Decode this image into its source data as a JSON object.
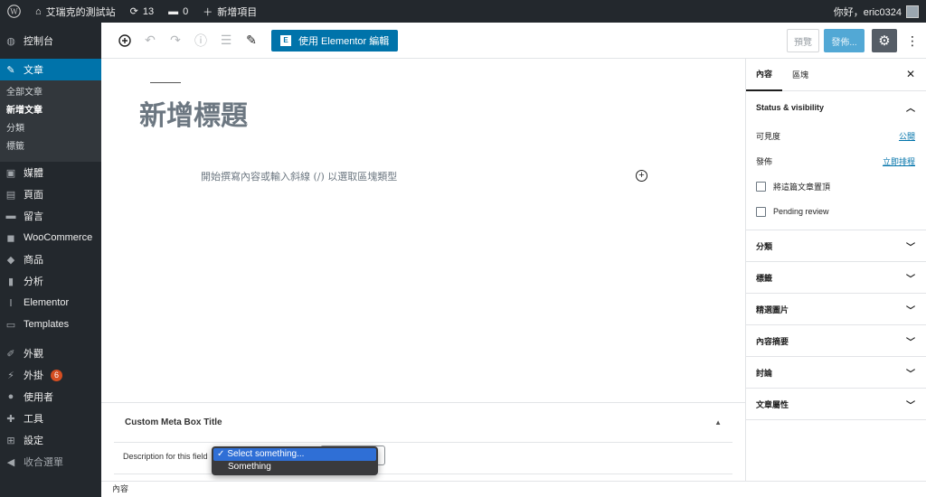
{
  "adminbar": {
    "site_name": "艾瑞克的測試站",
    "updates_count": "13",
    "comments_count": "0",
    "new_item": "新增項目",
    "greeting": "你好，eric0324"
  },
  "sidebar": {
    "items": [
      {
        "label": "控制台",
        "icon": "dashboard-icon"
      },
      {
        "label": "文章",
        "icon": "pin-icon"
      },
      {
        "label": "媒體",
        "icon": "media-icon"
      },
      {
        "label": "頁面",
        "icon": "page-icon"
      },
      {
        "label": "留言",
        "icon": "comment-icon"
      },
      {
        "label": "WooCommerce",
        "icon": "woocommerce-icon"
      },
      {
        "label": "商品",
        "icon": "product-icon"
      },
      {
        "label": "分析",
        "icon": "analytics-icon"
      },
      {
        "label": "Elementor",
        "icon": "elementor-icon"
      },
      {
        "label": "Templates",
        "icon": "folder-icon"
      },
      {
        "label": "外觀",
        "icon": "brush-icon"
      },
      {
        "label": "外掛",
        "icon": "plugin-icon",
        "badge": "6"
      },
      {
        "label": "使用者",
        "icon": "user-icon"
      },
      {
        "label": "工具",
        "icon": "wrench-icon"
      },
      {
        "label": "設定",
        "icon": "settings-icon"
      },
      {
        "label": "收合選單",
        "icon": "collapse-icon"
      }
    ],
    "submenu": [
      "全部文章",
      "新增文章",
      "分類",
      "標籤"
    ]
  },
  "toolbar": {
    "elementor_label": "使用 Elementor 編輯",
    "preview_label": "預覽",
    "publish_label": "發佈..."
  },
  "editor": {
    "title_placeholder": "新增標題",
    "appender_text": "開始撰寫內容或輸入斜線 (/) 以選取區塊類型"
  },
  "metabox": {
    "title": "Custom Meta Box Title",
    "field_label": "Description for this field",
    "options": [
      "Select something...",
      "Something"
    ]
  },
  "footer": {
    "breadcrumb": "內容"
  },
  "inspector": {
    "tabs": [
      "內容",
      "區塊"
    ],
    "status_title": "Status & visibility",
    "visibility_label": "可見度",
    "visibility_value": "公開",
    "publish_label": "發佈",
    "publish_value": "立即排程",
    "sticky_label": "將這篇文章置頂",
    "pending_label": "Pending review",
    "panels": [
      "分類",
      "標籤",
      "精選圖片",
      "內容摘要",
      "討論",
      "文章屬性"
    ]
  },
  "colors": {
    "admin_dark": "#23282d",
    "accent": "#0073aa"
  }
}
